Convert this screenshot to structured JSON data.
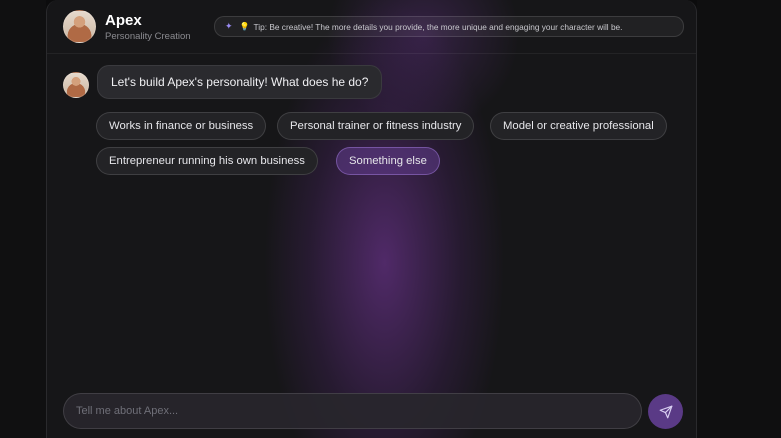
{
  "header": {
    "title": "Apex",
    "subtitle": "Personality Creation",
    "tip": "Tip: Be creative! The more details you provide, the more unique and engaging your character will be.",
    "tip_icons": [
      "sparkle-icon",
      "lightbulb-icon"
    ]
  },
  "message": {
    "text": "Let's build Apex's personality! What does he do?"
  },
  "options": [
    "Works in finance or business",
    "Personal trainer or fitness industry",
    "Model or creative professional",
    "Entrepreneur running his own business",
    "Something else"
  ],
  "composer": {
    "placeholder": "Tell me about Apex..."
  },
  "colors": {
    "accent": "#5a3a86",
    "chip_active": "#4a3070",
    "background": "#161618"
  }
}
